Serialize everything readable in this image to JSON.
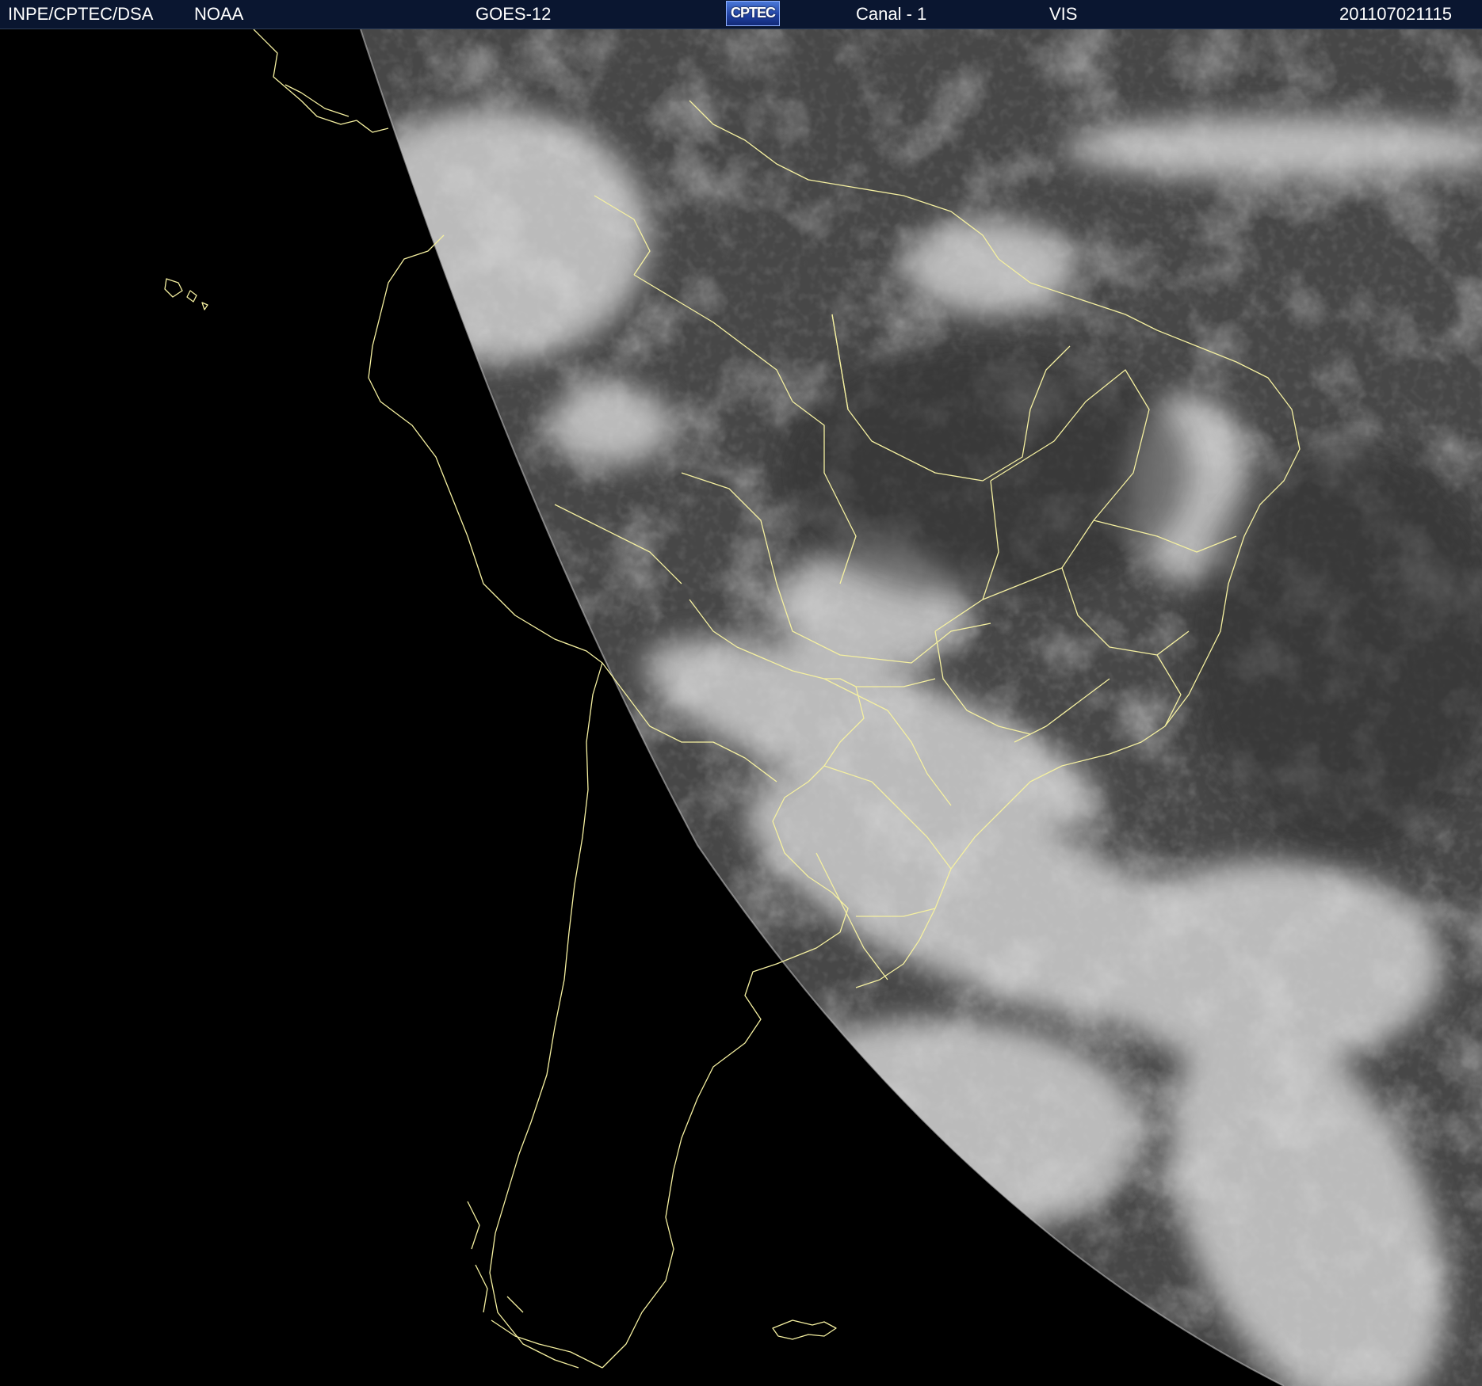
{
  "header": {
    "agency": "INPE/CPTEC/DSA",
    "source": "NOAA",
    "satellite": "GOES-12",
    "logo_text": "CPTEC",
    "channel": "Canal - 1",
    "band": "VIS",
    "timestamp": "201107021115"
  },
  "image": {
    "subject": "satellite visible image of South America",
    "colors": {
      "background": "#000000",
      "header_bg": "#0a1630",
      "borders": "#f5f0a0",
      "cloud": "#dcdcdc",
      "surface": "#474747"
    }
  }
}
